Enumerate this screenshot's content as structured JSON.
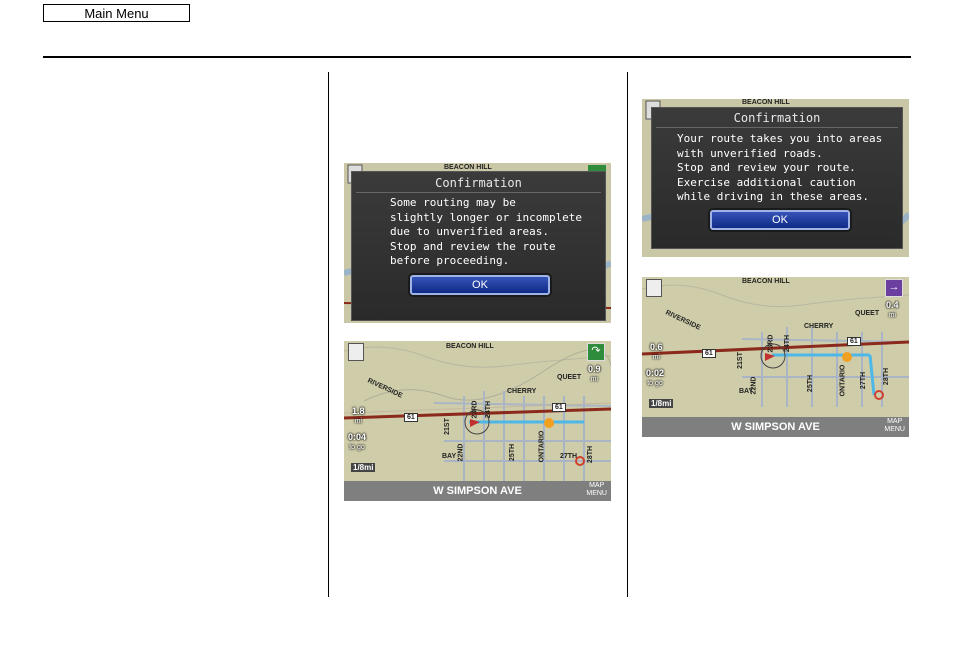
{
  "nav": {
    "main_menu": "Main Menu"
  },
  "dialog1": {
    "title": "Confirmation",
    "body": "Some routing may be\nslightly longer or incomplete\ndue to unverified areas.\nStop and review the route\nbefore proceeding.",
    "ok": "OK",
    "bg_label": "BEACON HILL"
  },
  "dialog2": {
    "title": "Confirmation",
    "body": "Your route takes you into areas\nwith unverified roads.\nStop and review your route.\nExercise additional caution\nwhile driving in these areas.",
    "ok": "OK",
    "bg_label": "BEACON HILL"
  },
  "map1": {
    "labels": {
      "beacon": "BEACON HILL",
      "riverside": "RIVERSIDE",
      "cherry": "CHERRY",
      "queet": "QUEET",
      "st21": "21ST",
      "nd22": "22ND",
      "rd23": "23RD",
      "th24": "24TH",
      "th25": "25TH",
      "ontario": "ONTARIO",
      "th27": "27TH",
      "th28": "28TH",
      "bay": "BAY"
    },
    "route_sign_a": "61",
    "route_sign_b": "61",
    "dist_top": "0.9",
    "dist_top_unit": "mi",
    "dist_left": "1.8",
    "dist_left_unit": "mi",
    "time": "0:04",
    "time_unit": "to go",
    "scale": "1/8mi",
    "street": "W SIMPSON AVE",
    "map_menu_1": "MAP",
    "map_menu_2": "MENU"
  },
  "map2": {
    "labels": {
      "beacon": "BEACON HILL",
      "riverside": "RIVERSIDE",
      "cherry": "CHERRY",
      "queet": "QUEET",
      "st21": "21ST",
      "nd22": "22ND",
      "rd23": "23RD",
      "th24": "24TH",
      "th25": "25TH",
      "ontario": "ONTARIO",
      "th27": "27TH",
      "th28": "28TH",
      "bay": "BAY"
    },
    "route_sign_a": "61",
    "route_sign_b": "61",
    "dist_top": "0.4",
    "dist_top_unit": "mi",
    "dist_left": "0.6",
    "dist_left_unit": "mi",
    "time": "0:02",
    "time_unit": "to go",
    "scale": "1/8mi",
    "street": "W SIMPSON AVE",
    "map_menu_1": "MAP",
    "map_menu_2": "MENU"
  }
}
